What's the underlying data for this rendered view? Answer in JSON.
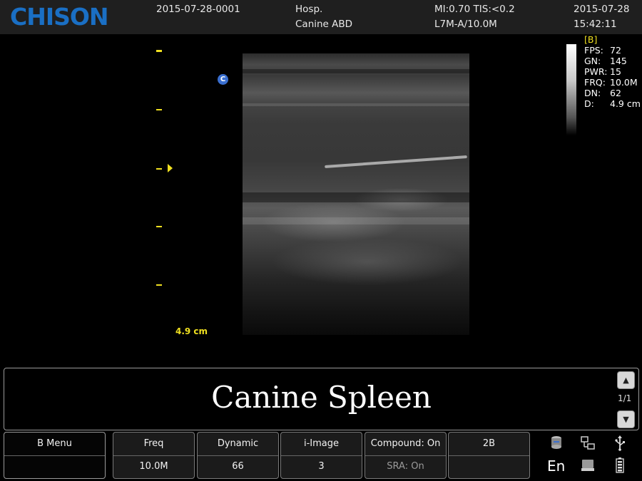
{
  "header": {
    "logo": "CHISON",
    "patient_id": "2015-07-28-0001",
    "hospital": "Hosp.",
    "exam": "Canine ABD",
    "mi_tis": "MI:0.70  TIS:<0.2",
    "probe": "L7M-A/10.0M",
    "date": "2015-07-28",
    "time": "15:42:11"
  },
  "image": {
    "depth_label": "4.9 cm",
    "orientation_marker": "C"
  },
  "params": {
    "mode": "[B]",
    "rows": [
      {
        "key": "FPS:",
        "value": "72"
      },
      {
        "key": "GN:",
        "value": "145"
      },
      {
        "key": "PWR:",
        "value": "15"
      },
      {
        "key": "FRQ:",
        "value": "10.0M"
      },
      {
        "key": "DN:",
        "value": "62"
      },
      {
        "key": "D:",
        "value": "4.9 cm"
      }
    ]
  },
  "comment": {
    "text": "Canine Spleen",
    "page": "1/1",
    "up_icon": "▲",
    "down_icon": "▼"
  },
  "menu": {
    "b_menu": "B Menu",
    "keys": [
      {
        "top": "Freq",
        "bottom": "10.0M"
      },
      {
        "top": "Dynamic",
        "bottom": "66"
      },
      {
        "top": "i-Image",
        "bottom": "3"
      },
      {
        "top": "Compound: On",
        "bottom": "SRA: On"
      },
      {
        "top": "2B",
        "bottom": ""
      }
    ]
  },
  "system": {
    "language": "En",
    "icons": [
      "disk-icon",
      "network-icon",
      "usb-icon",
      "hdd-icon",
      "battery-icon"
    ]
  },
  "colors": {
    "logo": "#1a6fc4",
    "annotation": "#f0e020",
    "marker": "#3a6fd0"
  }
}
